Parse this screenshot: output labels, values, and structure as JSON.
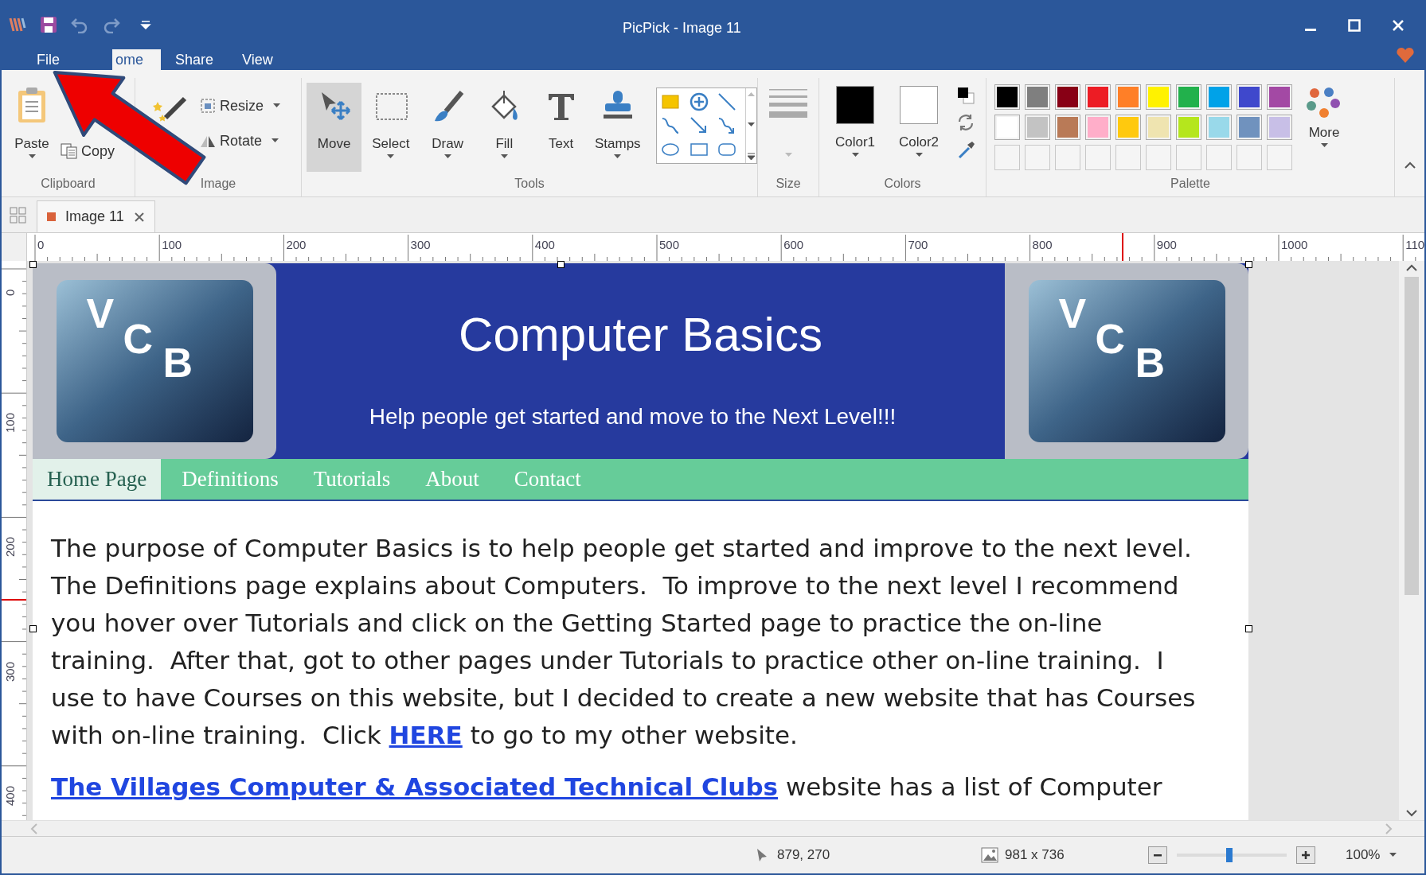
{
  "window": {
    "title": "PicPick - Image 11"
  },
  "ribbon_tabs": [
    {
      "label": "File",
      "selected": false
    },
    {
      "label": "ome",
      "selected": true
    },
    {
      "label": "Share",
      "selected": false
    },
    {
      "label": "View",
      "selected": false
    }
  ],
  "clipboard": {
    "label": "Clipboard",
    "paste": "Paste",
    "copy": "Copy"
  },
  "image_group": {
    "label": "Image",
    "resize": "Resize",
    "rotate": "Rotate"
  },
  "tools": {
    "label": "Tools",
    "items": [
      {
        "kind": "move",
        "label": "Move",
        "selected": true
      },
      {
        "kind": "select",
        "label": "Select",
        "selected": false
      },
      {
        "kind": "draw",
        "label": "Draw",
        "selected": false
      },
      {
        "kind": "fill",
        "label": "Fill",
        "selected": false
      },
      {
        "kind": "text",
        "label": "Text",
        "selected": false
      },
      {
        "kind": "stamps",
        "label": "Stamps",
        "selected": false
      }
    ]
  },
  "size": {
    "label": "Size"
  },
  "colors": {
    "label": "Colors",
    "color1": {
      "label": "Color1",
      "color": "#000000"
    },
    "color2": {
      "label": "Color2",
      "color": "#ffffff"
    }
  },
  "palette": {
    "label": "Palette",
    "more": "More",
    "swatches": [
      {
        "color": "#000000"
      },
      {
        "color": "#7f7f7f"
      },
      {
        "color": "#880015"
      },
      {
        "color": "#ed1c24"
      },
      {
        "color": "#ff7f27"
      },
      {
        "color": "#fff200"
      },
      {
        "color": "#22b14c"
      },
      {
        "color": "#00a2e8"
      },
      {
        "color": "#3f48cc"
      },
      {
        "color": "#a349a4"
      },
      {
        "color": "#ffffff"
      },
      {
        "color": "#c3c3c3"
      },
      {
        "color": "#b97a57"
      },
      {
        "color": "#ffaec9"
      },
      {
        "color": "#ffc90e"
      },
      {
        "color": "#efe4b0"
      },
      {
        "color": "#b5e61d"
      },
      {
        "color": "#99d9ea"
      },
      {
        "color": "#7092be"
      },
      {
        "color": "#c8bfe7"
      }
    ]
  },
  "document_tabs": [
    {
      "label": "Image 11",
      "selected": true
    }
  ],
  "ruler": {
    "horizontal": [
      "0",
      "100",
      "200",
      "300",
      "400",
      "500",
      "600",
      "700",
      "800",
      "900",
      "1000",
      "110"
    ],
    "vertical": [
      "0",
      "100",
      "200",
      "300",
      "400"
    ]
  },
  "page": {
    "logos": [
      {
        "letters": [
          "V",
          "C",
          "B"
        ]
      },
      {
        "letters": [
          "V",
          "C",
          "B"
        ]
      }
    ],
    "title": "Computer Basics",
    "subtitle": "Help people get started and move to the Next Level!!!",
    "nav": [
      {
        "label": "Home Page",
        "selected": true
      },
      {
        "label": "Definitions",
        "selected": false
      },
      {
        "label": "Tutorials",
        "selected": false
      },
      {
        "label": "About",
        "selected": false
      },
      {
        "label": "Contact",
        "selected": false
      }
    ],
    "paragraph_lines": [
      "The purpose of Computer Basics is to help people get started and improve to the next level.",
      "The Definitions page explains about Computers.  To improve to the next level I recommend",
      "you hover over Tutorials and click on the Getting Started page to practice the on-line",
      "training.  After that, got to other pages under Tutorials to practice other on-line training.  I",
      "use to have Courses on this website, but I decided to create a new website that has Courses"
    ],
    "paragraph_last_line": {
      "before": "with on-line training.  Click ",
      "link": "HERE",
      "after": " to go to my other website."
    },
    "second_paragraph": {
      "link": "The Villages Computer & Associated Technical Clubs",
      "text": " website has a list of Computer"
    }
  },
  "status_bar": {
    "cursor": "879, 270",
    "image_size": "981 x 736",
    "zoom": {
      "level": 0.48
    },
    "zoom_percent": "100%"
  }
}
